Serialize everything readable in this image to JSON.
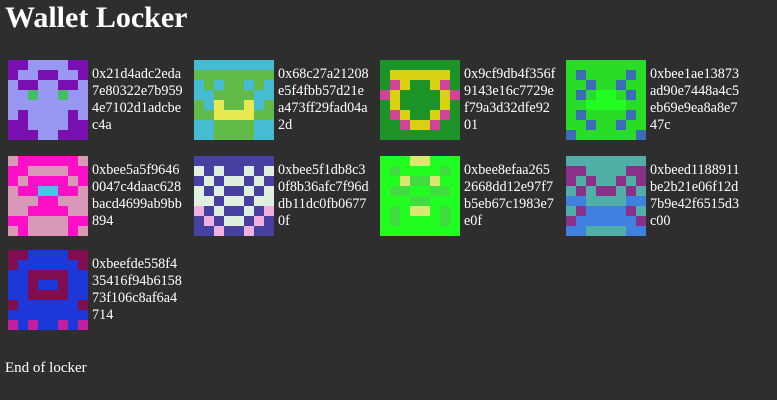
{
  "title": "Wallet Locker",
  "footer": "End of locker",
  "wallets": [
    {
      "address": "0x21d4adc2eda7e80322e7b9594e7102d1adcbec4a",
      "palette": [
        "#9898f0",
        "#7a10b0",
        "#40c060"
      ],
      "grid": [
        "11000011",
        "10011001",
        "01100110",
        "00200200",
        "00000000",
        "01000010",
        "11000011",
        "11100111"
      ]
    },
    {
      "address": "0x68c27a21208e5f4fbb57d21ea473ff29fad04a2d",
      "palette": [
        "#62bb48",
        "#45bcd2",
        "#e8e850"
      ],
      "grid": [
        "11111111",
        "00000000",
        "10100101",
        "11000011",
        "01200210",
        "00222200",
        "11000011",
        "11000011"
      ]
    },
    {
      "address": "0x9cf9db4f356f9143e16c7729ef79a3d32dfe9201",
      "palette": [
        "#1c9428",
        "#d8d010",
        "#d04498"
      ],
      "grid": [
        "00000000",
        "01111110",
        "02100120",
        "21000012",
        "01000010",
        "02100120",
        "00211200",
        "00000000"
      ]
    },
    {
      "address": "0xbee1ae13873ad90e7448a4c5eb69e9ea8a8e747c",
      "palette": [
        "#28dc28",
        "#3c6cb8",
        "#20ff20"
      ],
      "grid": [
        "00000000",
        "01000010",
        "00100100",
        "01022010",
        "00222200",
        "01000010",
        "00100100",
        "10000001"
      ]
    },
    {
      "address": "0xbee5a5f96460047c4daac628bacd4699ab9bb894",
      "palette": [
        "#d898b8",
        "#ff10c8",
        "#40c8e8"
      ],
      "grid": [
        "01111110",
        "11000011",
        "10111101",
        "01122110",
        "00011000",
        "00111100",
        "11000011",
        "01000010"
      ]
    },
    {
      "address": "0xbee5f1db8c30f8b36afc7f96ddb11dc0fb06770f",
      "palette": [
        "#e0f0e0",
        "#4840a0",
        "#f0b0e0"
      ],
      "grid": [
        "11111111",
        "01011010",
        "10100101",
        "01011010",
        "00100100",
        "21011012",
        "12100121",
        "11211211"
      ]
    },
    {
      "address": "0xbee8efaa2652668dd12e97f7b5eb67c1983e7e0f",
      "palette": [
        "#20ff20",
        "#40dc40",
        "#d8e870"
      ],
      "grid": [
        "00022000",
        "01000010",
        "00211200",
        "01100110",
        "00011000",
        "01022010",
        "01000010",
        "00000000"
      ]
    },
    {
      "address": "0xbeed1188911be2b21e06f12d7b9e42f6515d3c00",
      "palette": [
        "#50b0a8",
        "#8a3088",
        "#4080e0"
      ],
      "grid": [
        "00000000",
        "11000011",
        "10100101",
        "01011010",
        "22000022",
        "01222210",
        "12222221",
        "22000022"
      ]
    },
    {
      "address": "0xbeefde558f435416f94b615873f106c8af6a4714",
      "palette": [
        "#800d50",
        "#1c38d8",
        "#c020a0"
      ],
      "grid": [
        "00111100",
        "01111110",
        "11000011",
        "11011011",
        "11000011",
        "01111110",
        "11111111",
        "21211212"
      ]
    }
  ]
}
